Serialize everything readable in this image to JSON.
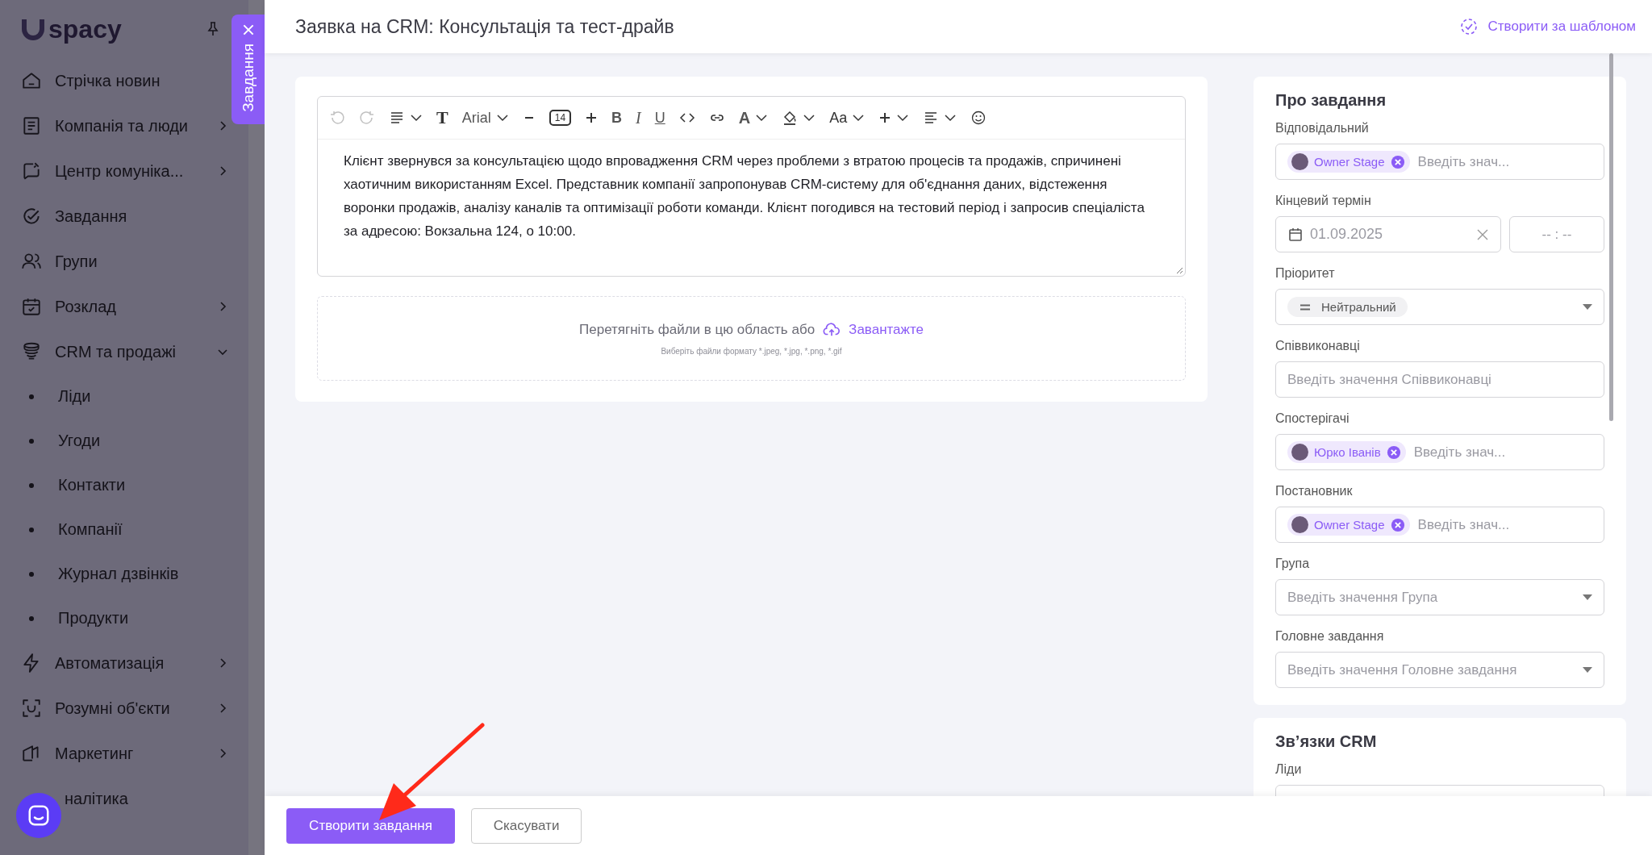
{
  "sidebar": {
    "logo": "spacy",
    "items": [
      {
        "label": "Стрічка новин"
      },
      {
        "label": "Компанія та люди",
        "expanded": false
      },
      {
        "label": "Центр комуніка...",
        "expanded": false
      },
      {
        "label": "Завдання"
      },
      {
        "label": "Групи"
      },
      {
        "label": "Розклад",
        "expanded": false
      },
      {
        "label": "CRM та продажі",
        "expanded": true,
        "children": [
          {
            "label": "Ліди"
          },
          {
            "label": "Угоди"
          },
          {
            "label": "Контакти"
          },
          {
            "label": "Компанії"
          },
          {
            "label": "Журнал дзвінків"
          },
          {
            "label": "Продукти"
          }
        ]
      },
      {
        "label": "Автоматизація",
        "expanded": false
      },
      {
        "label": "Розумні об'єкти",
        "expanded": false
      },
      {
        "label": "Маркетинг",
        "expanded": false
      },
      {
        "label": "налітика"
      }
    ]
  },
  "side_tab": {
    "label": "Завдання"
  },
  "header": {
    "title": "Заявка на CRM: Консультація та тест-драйв",
    "template_button": "Створити за шаблоном"
  },
  "editor": {
    "toolbar": [
      {
        "kind": "undo",
        "disabled": true
      },
      {
        "kind": "redo",
        "disabled": true
      },
      {
        "kind": "lines",
        "caret": true
      },
      {
        "kind": "serif",
        "text": "T"
      },
      {
        "kind": "font",
        "text": "Arial",
        "caret": true
      },
      {
        "kind": "minus"
      },
      {
        "kind": "size",
        "text": "14"
      },
      {
        "kind": "plus"
      },
      {
        "kind": "bold",
        "text": "B"
      },
      {
        "kind": "italic",
        "text": "I"
      },
      {
        "kind": "underline",
        "text": "U"
      },
      {
        "kind": "code"
      },
      {
        "kind": "link"
      },
      {
        "kind": "color",
        "text": "A",
        "caret": true
      },
      {
        "kind": "fill",
        "caret": true
      },
      {
        "kind": "case",
        "text": "Aa",
        "caret": true
      },
      {
        "kind": "plus",
        "caret": true
      },
      {
        "kind": "align",
        "caret": true
      },
      {
        "kind": "emoji"
      }
    ],
    "text": "Клієнт звернувся за консультацією щодо впровадження CRM через проблеми з втратою процесів та продажів, спричинені хаотичним використанням Excel. Представник компанії запропонував CRM-систему для об'єднання даних, відстеження воронки продажів, аналізу каналів та оптимізації роботи команди. Клієнт погодився на тестовий період і запросив спеціаліста за адресою: Вокзальна 124, о 10:00."
  },
  "upload": {
    "prompt": "Перетягніть файли в цю область або",
    "link": "Завантажте",
    "hint": "Виберіть файли формату *.jpeg, *.jpg, *.png, *.gif"
  },
  "about": {
    "title": "Про завдання",
    "fields": [
      {
        "label": "Відповідальний",
        "kind": "people",
        "chips": [
          {
            "name": "Owner Stage"
          }
        ],
        "placeholder": "Введіть знач..."
      },
      {
        "label": "Кінцевий термін",
        "kind": "date",
        "value": "01.09.2025",
        "time_placeholder": "-- : --"
      },
      {
        "label": "Пріоритет",
        "kind": "priority",
        "value": "Нейтральний"
      },
      {
        "label": "Співвиконавці",
        "kind": "text",
        "placeholder": "Введіть значення Співвиконавці"
      },
      {
        "label": "Спостерігачі",
        "kind": "people",
        "chips": [
          {
            "name": "Юрко Іванів"
          }
        ],
        "placeholder": "Введіть знач..."
      },
      {
        "label": "Постановник",
        "kind": "people",
        "chips": [
          {
            "name": "Owner Stage"
          }
        ],
        "placeholder": "Введіть знач..."
      },
      {
        "label": "Група",
        "kind": "select",
        "placeholder": "Введіть значення Група"
      },
      {
        "label": "Головне завдання",
        "kind": "select",
        "placeholder": "Введіть значення Головне завдання"
      }
    ]
  },
  "crm_links": {
    "title": "Зв’язки CRM",
    "fields": [
      {
        "label": "Ліди"
      }
    ]
  },
  "footer": {
    "buttons": [
      {
        "label": "Створити завдання",
        "kind": "primary"
      },
      {
        "label": "Скасувати",
        "kind": "secondary"
      }
    ]
  }
}
